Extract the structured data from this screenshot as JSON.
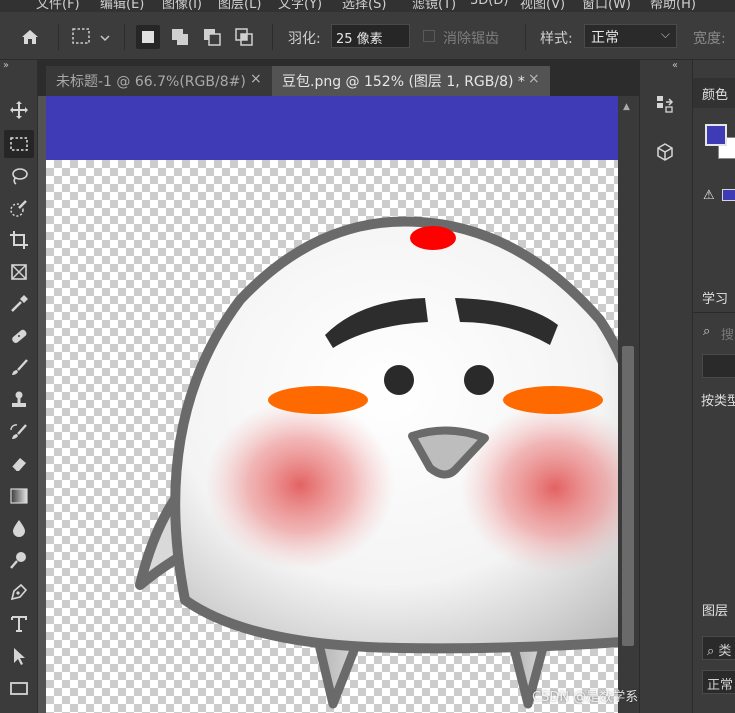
{
  "menubar": {
    "items": [
      "文件(F)",
      "编辑(E)",
      "图像(I)",
      "图层(L)",
      "文字(Y)",
      "选择(S)",
      "滤镜(T)",
      "3D(D)",
      "视图(V)",
      "窗口(W)",
      "帮助(H)"
    ]
  },
  "options": {
    "feather_label": "羽化:",
    "feather_value": "25 像素",
    "antialias_label": "消除锯齿",
    "style_label": "样式:",
    "style_value": "正常",
    "width_label": "宽度:"
  },
  "tabs": [
    {
      "title": "未标题-1 @ 66.7%(RGB/8#)",
      "close": "×"
    },
    {
      "title": "豆包.png @ 152% (图层 1, RGB/8) *",
      "close": "×"
    }
  ],
  "panels": {
    "color_title": "颜色",
    "learn_title": "学习",
    "search_placeholder": "搜",
    "filter_by_type": "按类型",
    "layers_title": "图层",
    "layer_kind_filter": "类",
    "blend_mode": "正常"
  },
  "colors": {
    "foreground": "#3f3bb7",
    "background": "#ffffff"
  },
  "watermark": "CSDN @是数学系的小孩儿"
}
